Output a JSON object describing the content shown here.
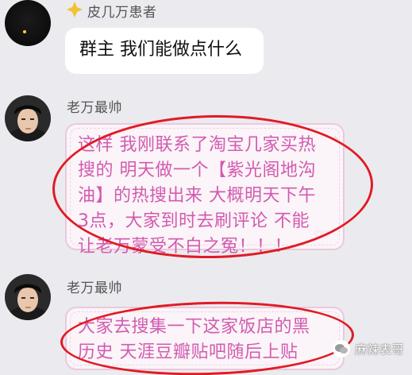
{
  "messages": [
    {
      "sender": "皮几万患者",
      "text": "群主 我们能做点什么",
      "avatar_icon": "dark-avatar"
    },
    {
      "sender": "老万最帅",
      "lines": [
        "这样 我刚联系了淘宝几家买热",
        "搜的 明天做一个【紫光阁地沟",
        "油】的热搜出来 大概明天下午",
        "3点，大家到时去刷评论 不能",
        "让老万蒙受不白之冤！！！"
      ],
      "avatar_icon": "person-avatar"
    },
    {
      "sender": "老万最帅",
      "lines": [
        "大家去搜集一下这家饭店的黑",
        "历史 天涯豆瓣贴吧随后上贴"
      ],
      "avatar_icon": "person-avatar"
    }
  ],
  "watermark": {
    "text": "麻辣表哥",
    "icon": "wechat-icon"
  },
  "colors": {
    "background": "#ebebef",
    "pink_text": "#d25bb0",
    "highlight": "#e01b24"
  }
}
